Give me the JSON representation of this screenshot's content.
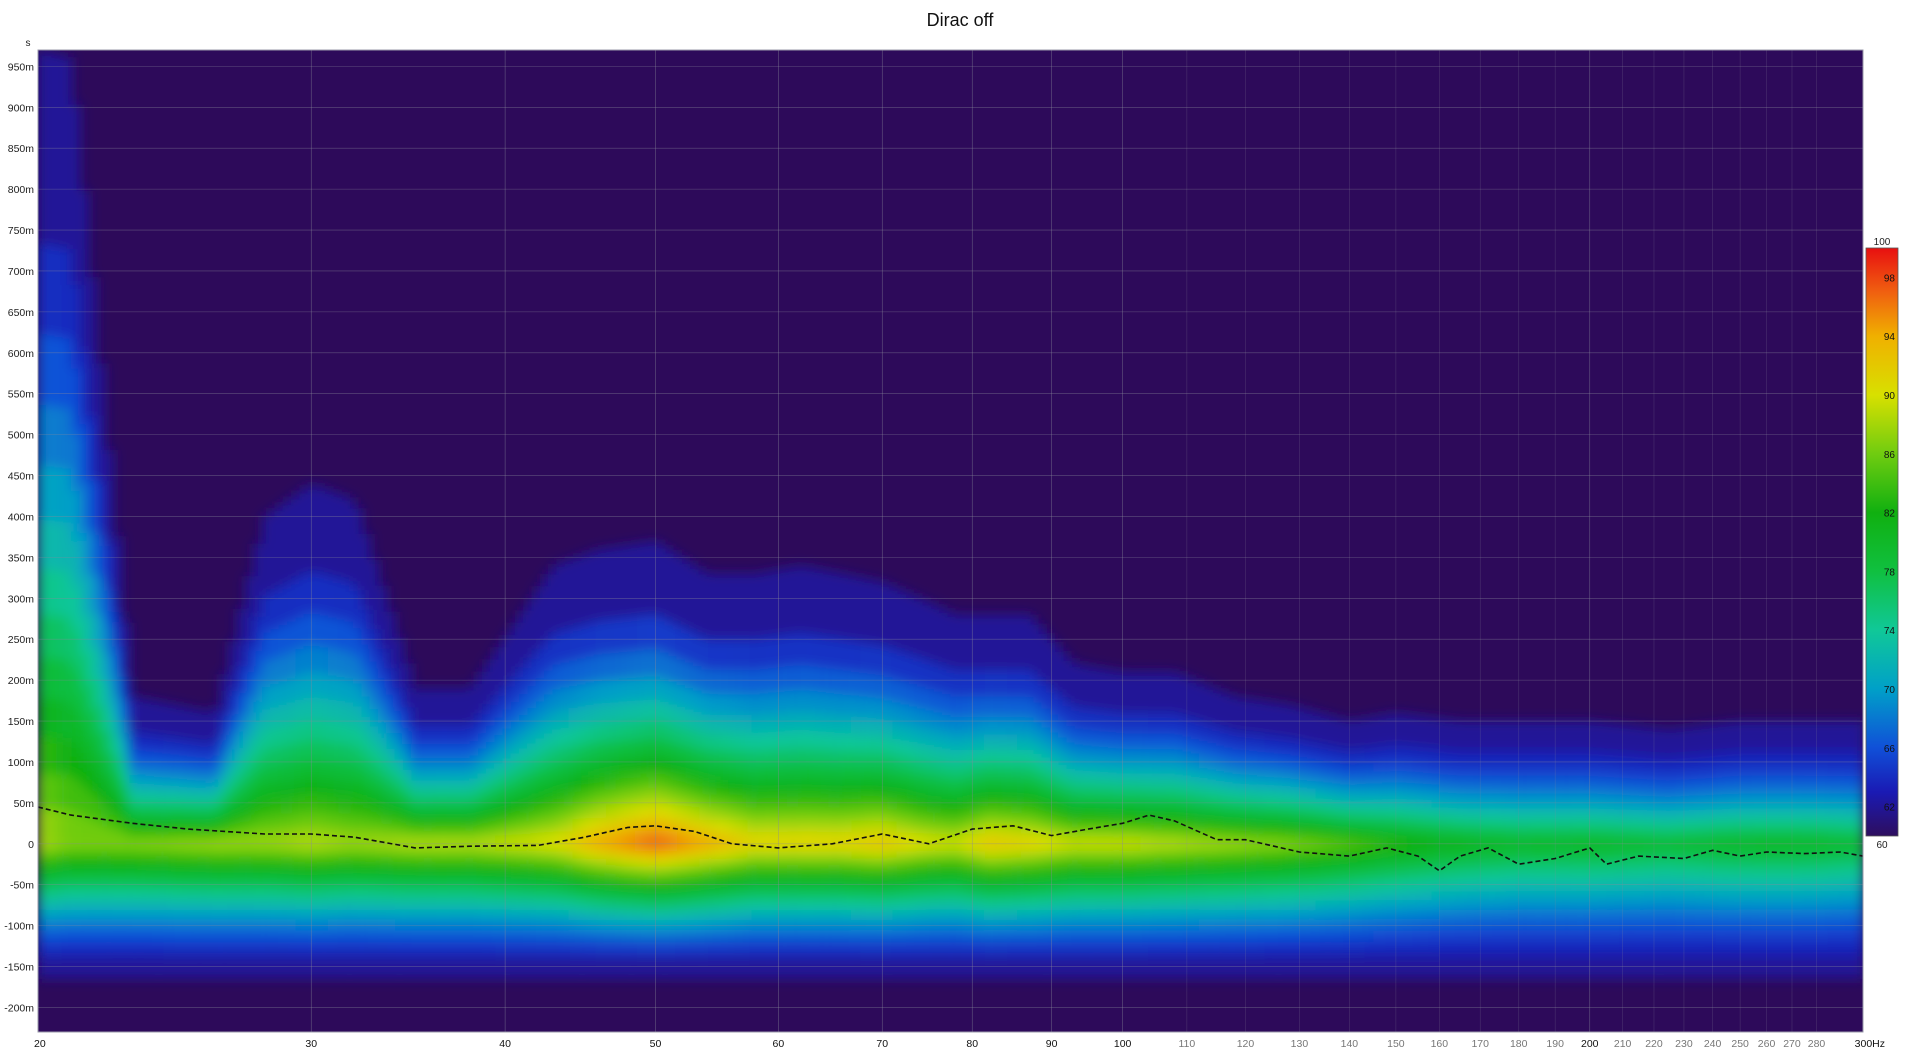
{
  "chart_data": {
    "type": "heatmap",
    "title": "Dirac off",
    "xlabel": "",
    "ylabel": "",
    "x_unit_label": "Hz",
    "y_unit_label": "s",
    "x_scale": "log",
    "xlim": [
      20,
      300
    ],
    "ylim": [
      -0.23,
      0.97
    ],
    "grid": true,
    "x_ticks": [
      {
        "value": 20,
        "label": "20",
        "major": true
      },
      {
        "value": 30,
        "label": "30",
        "major": true
      },
      {
        "value": 40,
        "label": "40",
        "major": true
      },
      {
        "value": 50,
        "label": "50",
        "major": true
      },
      {
        "value": 60,
        "label": "60",
        "major": true
      },
      {
        "value": 70,
        "label": "70",
        "major": true
      },
      {
        "value": 80,
        "label": "80",
        "major": true
      },
      {
        "value": 90,
        "label": "90",
        "major": true
      },
      {
        "value": 100,
        "label": "100",
        "major": true
      },
      {
        "value": 110,
        "label": "110",
        "major": false
      },
      {
        "value": 120,
        "label": "120",
        "major": false
      },
      {
        "value": 130,
        "label": "130",
        "major": false
      },
      {
        "value": 140,
        "label": "140",
        "major": false
      },
      {
        "value": 150,
        "label": "150",
        "major": false
      },
      {
        "value": 160,
        "label": "160",
        "major": false
      },
      {
        "value": 170,
        "label": "170",
        "major": false
      },
      {
        "value": 180,
        "label": "180",
        "major": false
      },
      {
        "value": 190,
        "label": "190",
        "major": false
      },
      {
        "value": 200,
        "label": "200",
        "major": true
      },
      {
        "value": 210,
        "label": "210",
        "major": false
      },
      {
        "value": 220,
        "label": "220",
        "major": false
      },
      {
        "value": 230,
        "label": "230",
        "major": false
      },
      {
        "value": 240,
        "label": "240",
        "major": false
      },
      {
        "value": 250,
        "label": "250",
        "major": false
      },
      {
        "value": 260,
        "label": "260",
        "major": false
      },
      {
        "value": 270,
        "label": "270",
        "major": false
      },
      {
        "value": 280,
        "label": "280",
        "major": false
      },
      {
        "value": 300,
        "label": "300Hz",
        "major": true
      }
    ],
    "y_ticks": [
      {
        "value": 0.95,
        "label": "950m"
      },
      {
        "value": 0.9,
        "label": "900m"
      },
      {
        "value": 0.85,
        "label": "850m"
      },
      {
        "value": 0.8,
        "label": "800m"
      },
      {
        "value": 0.75,
        "label": "750m"
      },
      {
        "value": 0.7,
        "label": "700m"
      },
      {
        "value": 0.65,
        "label": "650m"
      },
      {
        "value": 0.6,
        "label": "600m"
      },
      {
        "value": 0.55,
        "label": "550m"
      },
      {
        "value": 0.5,
        "label": "500m"
      },
      {
        "value": 0.45,
        "label": "450m"
      },
      {
        "value": 0.4,
        "label": "400m"
      },
      {
        "value": 0.35,
        "label": "350m"
      },
      {
        "value": 0.3,
        "label": "300m"
      },
      {
        "value": 0.25,
        "label": "250m"
      },
      {
        "value": 0.2,
        "label": "200m"
      },
      {
        "value": 0.15,
        "label": "150m"
      },
      {
        "value": 0.1,
        "label": "100m"
      },
      {
        "value": 0.05,
        "label": "50m"
      },
      {
        "value": 0.0,
        "label": "0"
      },
      {
        "value": -0.05,
        "label": "-50m"
      },
      {
        "value": -0.1,
        "label": "-100m"
      },
      {
        "value": -0.15,
        "label": "-150m"
      },
      {
        "value": -0.2,
        "label": "-200m"
      }
    ],
    "colorbar": {
      "range": [
        60,
        100
      ],
      "ticks": [
        {
          "value": 100,
          "label": "100"
        },
        {
          "value": 98,
          "label": "98"
        },
        {
          "value": 94,
          "label": "94"
        },
        {
          "value": 90,
          "label": "90"
        },
        {
          "value": 86,
          "label": "86"
        },
        {
          "value": 82,
          "label": "82"
        },
        {
          "value": 78,
          "label": "78"
        },
        {
          "value": 74,
          "label": "74"
        },
        {
          "value": 70,
          "label": "70"
        },
        {
          "value": 66,
          "label": "66"
        },
        {
          "value": 62,
          "label": "62"
        },
        {
          "value": 60,
          "label": "60"
        }
      ],
      "stops": [
        {
          "value": 60,
          "color": "#2e0e5e"
        },
        {
          "value": 63,
          "color": "#1a1ab4"
        },
        {
          "value": 66,
          "color": "#1050d8"
        },
        {
          "value": 70,
          "color": "#00a0c8"
        },
        {
          "value": 74,
          "color": "#10c898"
        },
        {
          "value": 78,
          "color": "#10c040"
        },
        {
          "value": 82,
          "color": "#10b010"
        },
        {
          "value": 86,
          "color": "#70cc10"
        },
        {
          "value": 90,
          "color": "#d8e000"
        },
        {
          "value": 94,
          "color": "#f0b000"
        },
        {
          "value": 97,
          "color": "#f06010"
        },
        {
          "value": 100,
          "color": "#e81010"
        }
      ]
    },
    "background_color": "#2d0a5a",
    "ridges": [
      {
        "f": 20,
        "top": 0.97,
        "peak": 90,
        "bw": 0.04
      },
      {
        "f": 21,
        "top": 0.96,
        "peak": 88,
        "bw": 0.03
      },
      {
        "f": 23,
        "top": 0.18,
        "peak": 88,
        "bw": 0.02
      },
      {
        "f": 26,
        "top": 0.16,
        "peak": 89,
        "bw": 0.02
      },
      {
        "f": 28,
        "top": 0.4,
        "peak": 89,
        "bw": 0.02
      },
      {
        "f": 30,
        "top": 0.44,
        "peak": 90,
        "bw": 0.02
      },
      {
        "f": 32,
        "top": 0.42,
        "peak": 89,
        "bw": 0.02
      },
      {
        "f": 35,
        "top": 0.19,
        "peak": 90,
        "bw": 0.015
      },
      {
        "f": 38,
        "top": 0.19,
        "peak": 90,
        "bw": 0.015
      },
      {
        "f": 43,
        "top": 0.34,
        "peak": 92,
        "bw": 0.015
      },
      {
        "f": 46,
        "top": 0.36,
        "peak": 96,
        "bw": 0.015
      },
      {
        "f": 50,
        "top": 0.37,
        "peak": 99,
        "bw": 0.015
      },
      {
        "f": 54,
        "top": 0.33,
        "peak": 96,
        "bw": 0.015
      },
      {
        "f": 58,
        "top": 0.33,
        "peak": 93,
        "bw": 0.012
      },
      {
        "f": 62,
        "top": 0.34,
        "peak": 93,
        "bw": 0.012
      },
      {
        "f": 66,
        "top": 0.33,
        "peak": 93,
        "bw": 0.012
      },
      {
        "f": 70,
        "top": 0.32,
        "peak": 94,
        "bw": 0.012
      },
      {
        "f": 74,
        "top": 0.3,
        "peak": 92,
        "bw": 0.012
      },
      {
        "f": 78,
        "top": 0.28,
        "peak": 91,
        "bw": 0.012
      },
      {
        "f": 82,
        "top": 0.28,
        "peak": 94,
        "bw": 0.012
      },
      {
        "f": 87,
        "top": 0.28,
        "peak": 93,
        "bw": 0.012
      },
      {
        "f": 93,
        "top": 0.22,
        "peak": 91,
        "bw": 0.012
      },
      {
        "f": 100,
        "top": 0.21,
        "peak": 91,
        "bw": 0.012
      },
      {
        "f": 108,
        "top": 0.21,
        "peak": 90,
        "bw": 0.012
      },
      {
        "f": 118,
        "top": 0.18,
        "peak": 89,
        "bw": 0.01
      },
      {
        "f": 128,
        "top": 0.17,
        "peak": 88,
        "bw": 0.01
      },
      {
        "f": 140,
        "top": 0.15,
        "peak": 86,
        "bw": 0.01
      },
      {
        "f": 150,
        "top": 0.16,
        "peak": 84,
        "bw": 0.01
      },
      {
        "f": 165,
        "top": 0.15,
        "peak": 82,
        "bw": 0.01
      },
      {
        "f": 180,
        "top": 0.15,
        "peak": 81,
        "bw": 0.01
      },
      {
        "f": 200,
        "top": 0.15,
        "peak": 81,
        "bw": 0.01
      },
      {
        "f": 225,
        "top": 0.14,
        "peak": 80,
        "bw": 0.01
      },
      {
        "f": 250,
        "top": 0.15,
        "peak": 81,
        "bw": 0.01
      },
      {
        "f": 275,
        "top": 0.15,
        "peak": 81,
        "bw": 0.01
      },
      {
        "f": 300,
        "top": 0.15,
        "peak": 80,
        "bw": 0.01
      }
    ],
    "series": [
      {
        "type": "line",
        "style": "dashed",
        "color": "#111111",
        "points": [
          {
            "x": 20,
            "y": 0.045
          },
          {
            "x": 21,
            "y": 0.035
          },
          {
            "x": 23,
            "y": 0.025
          },
          {
            "x": 25,
            "y": 0.018
          },
          {
            "x": 28,
            "y": 0.012
          },
          {
            "x": 30,
            "y": 0.012
          },
          {
            "x": 32,
            "y": 0.008
          },
          {
            "x": 35,
            "y": -0.005
          },
          {
            "x": 38,
            "y": -0.003
          },
          {
            "x": 42,
            "y": -0.002
          },
          {
            "x": 45,
            "y": 0.008
          },
          {
            "x": 48,
            "y": 0.02
          },
          {
            "x": 50,
            "y": 0.022
          },
          {
            "x": 53,
            "y": 0.015
          },
          {
            "x": 56,
            "y": 0.0
          },
          {
            "x": 60,
            "y": -0.005
          },
          {
            "x": 65,
            "y": 0.0
          },
          {
            "x": 70,
            "y": 0.012
          },
          {
            "x": 75,
            "y": 0.0
          },
          {
            "x": 80,
            "y": 0.018
          },
          {
            "x": 85,
            "y": 0.022
          },
          {
            "x": 90,
            "y": 0.01
          },
          {
            "x": 95,
            "y": 0.018
          },
          {
            "x": 100,
            "y": 0.025
          },
          {
            "x": 104,
            "y": 0.035
          },
          {
            "x": 108,
            "y": 0.028
          },
          {
            "x": 115,
            "y": 0.005
          },
          {
            "x": 120,
            "y": 0.005
          },
          {
            "x": 130,
            "y": -0.01
          },
          {
            "x": 140,
            "y": -0.015
          },
          {
            "x": 148,
            "y": -0.005
          },
          {
            "x": 155,
            "y": -0.015
          },
          {
            "x": 160,
            "y": -0.033
          },
          {
            "x": 165,
            "y": -0.015
          },
          {
            "x": 172,
            "y": -0.005
          },
          {
            "x": 180,
            "y": -0.025
          },
          {
            "x": 190,
            "y": -0.018
          },
          {
            "x": 200,
            "y": -0.005
          },
          {
            "x": 205,
            "y": -0.025
          },
          {
            "x": 215,
            "y": -0.015
          },
          {
            "x": 230,
            "y": -0.018
          },
          {
            "x": 240,
            "y": -0.008
          },
          {
            "x": 250,
            "y": -0.015
          },
          {
            "x": 260,
            "y": -0.01
          },
          {
            "x": 275,
            "y": -0.012
          },
          {
            "x": 290,
            "y": -0.01
          },
          {
            "x": 300,
            "y": -0.015
          }
        ]
      }
    ]
  }
}
